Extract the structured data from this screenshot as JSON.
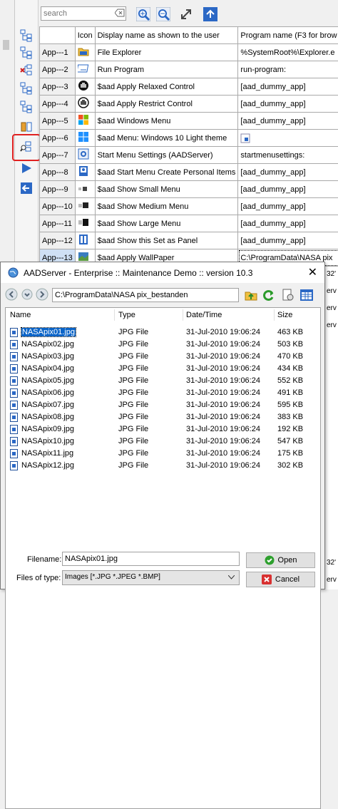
{
  "toolbar": {
    "search_placeholder": "search",
    "buttons": [
      "zoom-in-icon",
      "zoom-out-icon",
      "expand-icon",
      "up-arrow-icon"
    ]
  },
  "grid": {
    "headers": {
      "id": "",
      "icon": "Icon",
      "display": "Display name as shown to the user",
      "program": "Program name (F3 for brow"
    },
    "rows": [
      {
        "id": "App---1",
        "icon": "folder-icon",
        "display": "File Explorer",
        "program": "%SystemRoot%\\Explorer.e"
      },
      {
        "id": "App---2",
        "icon": "run-icon",
        "display": "Run Program",
        "program": "run-program:"
      },
      {
        "id": "App---3",
        "icon": "relaxed-icon",
        "display": "$aad Apply Relaxed Control",
        "program": "[aad_dummy_app]"
      },
      {
        "id": "App---4",
        "icon": "restrict-icon",
        "display": "$aad Apply Restrict Control",
        "program": "[aad_dummy_app]"
      },
      {
        "id": "App---5",
        "icon": "windows-color-icon",
        "display": "$aad Windows Menu",
        "program": "[aad_dummy_app]"
      },
      {
        "id": "App---6",
        "icon": "windows-blue-icon",
        "display": "$aad Menu: Windows 10 Light theme",
        "program": ""
      },
      {
        "id": "App---7",
        "icon": "settings-icon",
        "display": "Start Menu Settings (AADServer)",
        "program": "startmenusettings:"
      },
      {
        "id": "App---8",
        "icon": "personal-icon",
        "display": "$aad Start Menu Create Personal Items",
        "program": "[aad_dummy_app]"
      },
      {
        "id": "App---9",
        "icon": "small-menu-icon",
        "display": "$aad Show Small Menu",
        "program": "[aad_dummy_app]"
      },
      {
        "id": "App---10",
        "icon": "medium-menu-icon",
        "display": "$aad Show Medium Menu",
        "program": "[aad_dummy_app]"
      },
      {
        "id": "App---11",
        "icon": "large-menu-icon",
        "display": "$aad Show Large Menu",
        "program": "[aad_dummy_app]"
      },
      {
        "id": "App---12",
        "icon": "panel-icon",
        "display": "$aad Show this Set as Panel",
        "program": "[aad_dummy_app]"
      },
      {
        "id": "App---13",
        "icon": "wallpaper-icon",
        "display": "$aad Apply WallPaper",
        "program": "C:\\ProgramData\\NASA pix"
      }
    ],
    "peek_right": [
      "32'",
      "erv",
      "erv",
      "erv",
      "32'",
      "erv"
    ]
  },
  "dialog": {
    "title": "AADServer - Enterprise :: Maintenance Demo :: version 10.3",
    "path": "C:\\ProgramData\\NASA pix_bestanden",
    "columns": {
      "name": "Name",
      "type": "Type",
      "date": "Date/Time",
      "size": "Size"
    },
    "files": [
      {
        "name": "NASApix01.jpg",
        "type": "JPG File",
        "date": "31-Jul-2010 19:06:24",
        "size": "463 KB"
      },
      {
        "name": "NASApix02.jpg",
        "type": "JPG File",
        "date": "31-Jul-2010 19:06:24",
        "size": "503 KB"
      },
      {
        "name": "NASApix03.jpg",
        "type": "JPG File",
        "date": "31-Jul-2010 19:06:24",
        "size": "470 KB"
      },
      {
        "name": "NASApix04.jpg",
        "type": "JPG File",
        "date": "31-Jul-2010 19:06:24",
        "size": "434 KB"
      },
      {
        "name": "NASApix05.jpg",
        "type": "JPG File",
        "date": "31-Jul-2010 19:06:24",
        "size": "552 KB"
      },
      {
        "name": "NASApix06.jpg",
        "type": "JPG File",
        "date": "31-Jul-2010 19:06:24",
        "size": "491 KB"
      },
      {
        "name": "NASApix07.jpg",
        "type": "JPG File",
        "date": "31-Jul-2010 19:06:24",
        "size": "595 KB"
      },
      {
        "name": "NASApix08.jpg",
        "type": "JPG File",
        "date": "31-Jul-2010 19:06:24",
        "size": "383 KB"
      },
      {
        "name": "NASApix09.jpg",
        "type": "JPG File",
        "date": "31-Jul-2010 19:06:24",
        "size": "192 KB"
      },
      {
        "name": "NASApix10.jpg",
        "type": "JPG File",
        "date": "31-Jul-2010 19:06:24",
        "size": "547 KB"
      },
      {
        "name": "NASApix11.jpg",
        "type": "JPG File",
        "date": "31-Jul-2010 19:06:24",
        "size": "175 KB"
      },
      {
        "name": "NASApix12.jpg",
        "type": "JPG File",
        "date": "31-Jul-2010 19:06:24",
        "size": "302 KB"
      }
    ],
    "filename_label": "Filename:",
    "filename_value": "NASApix01.jpg",
    "filetype_label": "Files of type:",
    "filetype_value": "Images [*.JPG *.JPEG *.BMP]",
    "open_label": "Open",
    "cancel_label": "Cancel"
  },
  "colors": {
    "selection": "#0a64c8",
    "highlight_border": "#e02020",
    "accent_blue": "#2b68c5"
  }
}
